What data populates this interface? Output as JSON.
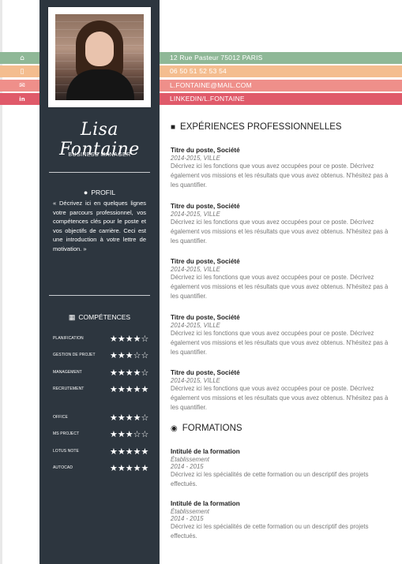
{
  "contact": [
    {
      "icon": "home-icon",
      "glyph": "⌂",
      "text": "12 Rue Pasteur 75012 PARIS",
      "color": "#8fb897"
    },
    {
      "icon": "phone-icon",
      "glyph": "▯",
      "text": "06 50 51 52 53 54",
      "color": "#f4bd8f"
    },
    {
      "icon": "mail-icon",
      "glyph": "✉",
      "text": "L.FONTAINE@MAIL.COM",
      "color": "#ef8f8a"
    },
    {
      "icon": "linkedin-icon",
      "glyph": "in",
      "text": "LINKEDIN/L.FONTAINE",
      "color": "#e05a6a"
    }
  ],
  "sidebar": {
    "name": "Lisa Fontaine",
    "role": "BUSINESS MANAGER",
    "profil": {
      "heading": "PROFIL",
      "text": "« Décrivez ici en quelques lignes votre parcours professionnel, vos compétences clés pour le poste et vos objectifs de carrière. Ceci est une introduction à votre lettre de motivation. »"
    },
    "competences": {
      "heading": "COMPÉTENCES",
      "skills": [
        {
          "name": "PLANIFICATION",
          "stars": "★★★★☆",
          "rating": 4
        },
        {
          "name": "GESTION DE PROJET",
          "stars": "★★★☆☆",
          "rating": 3
        },
        {
          "name": "MANAGEMENT",
          "stars": "★★★★☆",
          "rating": 4
        },
        {
          "name": "RECRUTEMENT",
          "stars": "★★★★★",
          "rating": 5
        },
        {
          "name": "OFFICE",
          "stars": "★★★★☆",
          "rating": 4
        },
        {
          "name": "MS PROJECT",
          "stars": "★★★☆☆",
          "rating": 3
        },
        {
          "name": "LOTUS NOTE",
          "stars": "★★★★★",
          "rating": 5
        },
        {
          "name": "AUTOCAD",
          "stars": "★★★★★",
          "rating": 5
        }
      ]
    }
  },
  "experiences": {
    "heading": "EXPÉRIENCES PROFESSIONNELLES",
    "items": [
      {
        "title": "Titre du poste, Société",
        "date": "2014-2015, VILLE",
        "desc": "Décrivez ici les fonctions que vous avez occupées pour ce poste. Décrivez également vos missions et les résultats que vous avez obtenus. N'hésitez pas à les quantifier."
      },
      {
        "title": "Titre du poste, Société",
        "date": "2014-2015, VILLE",
        "desc": "Décrivez ici les fonctions que vous avez occupées pour ce poste. Décrivez également vos missions et les résultats que vous avez obtenus. N'hésitez pas à les quantifier."
      },
      {
        "title": "Titre du poste, Société",
        "date": "2014-2015, VILLE",
        "desc": "Décrivez ici les fonctions que vous avez occupées pour ce poste. Décrivez également vos missions et les résultats que vous avez obtenus. N'hésitez pas à les quantifier."
      },
      {
        "title": "Titre du poste, Société",
        "date": "2014-2015, VILLE",
        "desc": "Décrivez ici les fonctions que vous avez occupées pour ce poste. Décrivez également vos missions et les résultats que vous avez obtenus. N'hésitez pas à les quantifier."
      },
      {
        "title": "Titre du poste, Société",
        "date": "2014-2015, VILLE",
        "desc": "Décrivez ici les fonctions que vous avez occupées pour ce poste. Décrivez également vos missions et les résultats que vous avez obtenus. N'hésitez pas à les quantifier."
      }
    ]
  },
  "formations": {
    "heading": "FORMATIONS",
    "items": [
      {
        "title": "Intitulé de la formation",
        "school": "Établissement",
        "date": "2014 - 2015",
        "desc": "Décrivez ici les spécialités de cette formation ou un descriptif des projets effectués."
      },
      {
        "title": "Intitulé de la formation",
        "school": "Établissement",
        "date": "2014 - 2015",
        "desc": "Décrivez ici les spécialités de cette formation ou un descriptif des projets effectués."
      }
    ]
  }
}
